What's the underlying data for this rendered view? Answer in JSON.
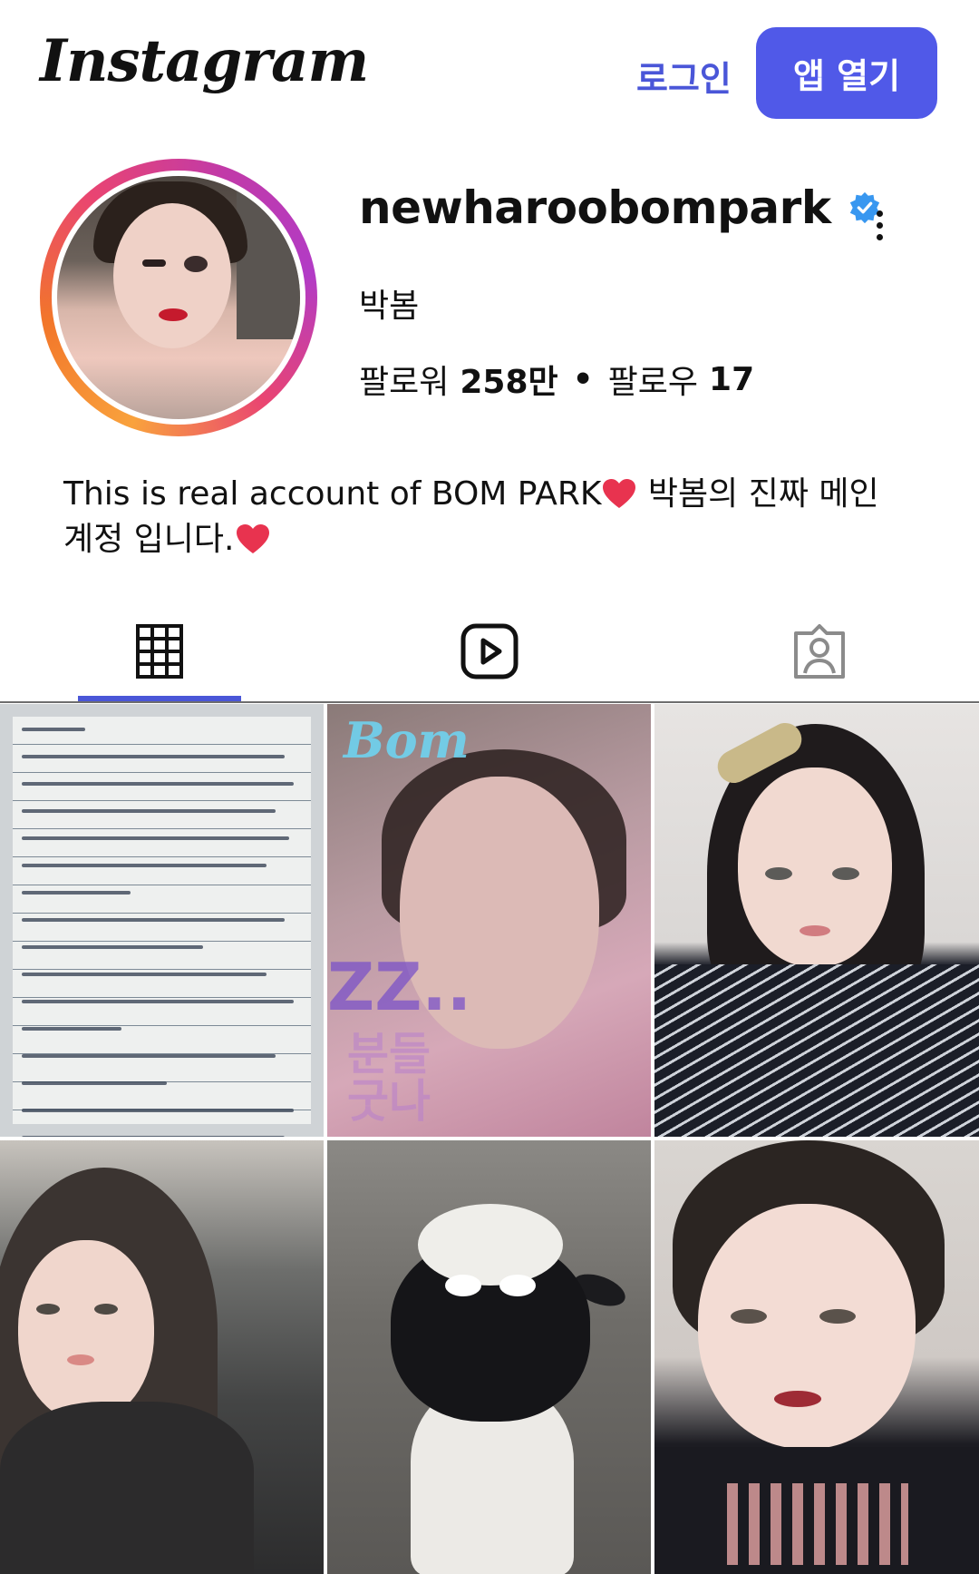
{
  "header": {
    "logo_text": "Instagram",
    "login_label": "로그인",
    "open_app_label": "앱 열기",
    "accent_color": "#5059e8"
  },
  "profile": {
    "username": "newharoobompark",
    "verified": true,
    "full_name": "박봄",
    "followers_label": "팔로워",
    "followers_count": "258만",
    "following_label": "팔로우",
    "following_count": "17",
    "bio_line1": "This is real account of BOM PARK",
    "bio_line1_suffix": "박봄의 진짜 메인",
    "bio_line2": "계정 입니다."
  },
  "tabs": [
    {
      "icon": "grid-icon",
      "selected": true
    },
    {
      "icon": "reels-icon",
      "selected": false
    },
    {
      "icon": "tagged-icon",
      "selected": false
    }
  ],
  "posts": [
    {
      "kind": "handwritten-letter"
    },
    {
      "kind": "blurry-photo",
      "overlay_text": "Bom",
      "overlay_text_2": "ZZ..",
      "overlay_text_3": "분들\n굿나"
    },
    {
      "kind": "portrait"
    },
    {
      "kind": "car-selfie"
    },
    {
      "kind": "plush-sheep"
    },
    {
      "kind": "selfie"
    }
  ]
}
